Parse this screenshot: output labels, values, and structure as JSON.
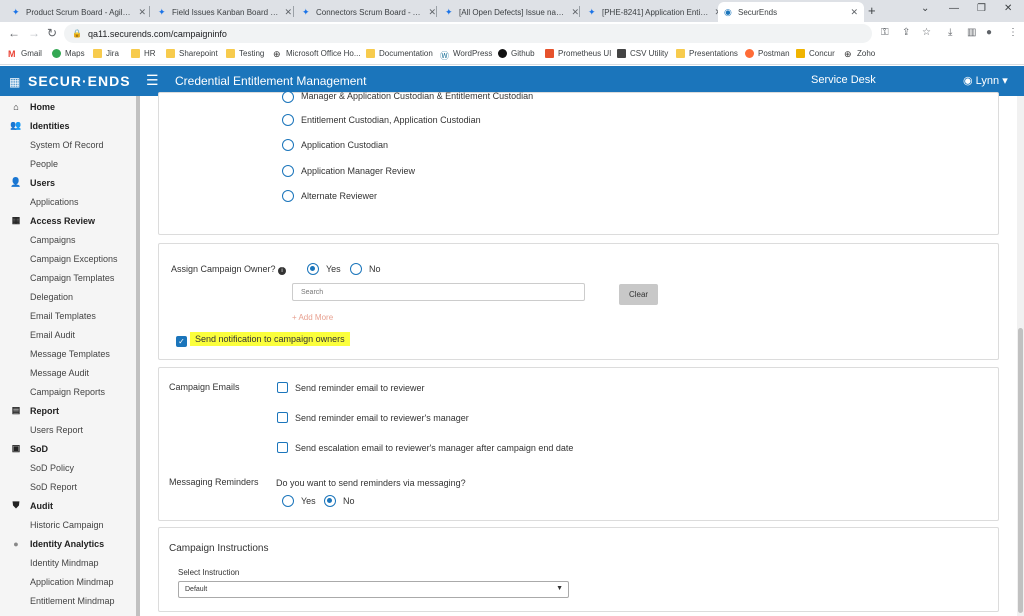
{
  "browser": {
    "tabs": [
      {
        "label": "Product Scrum Board - Agile Bo..."
      },
      {
        "label": "Field Issues Kanban Board - Agile..."
      },
      {
        "label": "Connectors Scrum Board - Agile..."
      },
      {
        "label": "[All Open Defects] Issue navigat..."
      },
      {
        "label": "[PHE-8241] Application Entitlem..."
      },
      {
        "label": "SecurEnds"
      }
    ],
    "url": "qa11.securends.com/campaigninfo",
    "bookmarks": [
      "Gmail",
      "Maps",
      "Jira",
      "HR",
      "Sharepoint",
      "Testing",
      "Microsoft Office Ho...",
      "Documentation",
      "WordPress",
      "Github",
      "Prometheus UI",
      "CSV Utility",
      "Presentations",
      "Postman",
      "Concur",
      "Zoho"
    ]
  },
  "app": {
    "logo": "SECUR·ENDS",
    "title": "Credential Entitlement Management",
    "service_desk": "Service Desk",
    "user": "Lynn"
  },
  "sidebar": {
    "sections": [
      {
        "label": "Home",
        "items": []
      },
      {
        "label": "Identities",
        "items": [
          "System Of Record",
          "People"
        ]
      },
      {
        "label": "Users",
        "items": [
          "Applications"
        ]
      },
      {
        "label": "Access Review",
        "items": [
          "Campaigns",
          "Campaign Exceptions",
          "Campaign Templates",
          "Delegation",
          "Email Templates",
          "Email Audit",
          "Message Templates",
          "Message Audit",
          "Campaign Reports"
        ]
      },
      {
        "label": "Report",
        "items": [
          "Users Report"
        ]
      },
      {
        "label": "SoD",
        "items": [
          "SoD Policy",
          "SoD Report"
        ]
      },
      {
        "label": "Audit",
        "items": [
          "Historic Campaign"
        ]
      },
      {
        "label": "Identity Analytics",
        "items": [
          "Identity Mindmap",
          "Application Mindmap",
          "Entitlement Mindmap"
        ]
      }
    ]
  },
  "reviewer_options": [
    "Manager & Application Custodian & Entitlement Custodian",
    "Entitlement Custodian, Application Custodian",
    "Application Custodian",
    "Application Manager Review",
    "Alternate Reviewer"
  ],
  "owner": {
    "label": "Assign Campaign Owner?",
    "yes": "Yes",
    "no": "No",
    "search_placeholder": "Search",
    "clear": "Clear",
    "add_more": "+ Add More",
    "notify": "Send notification to campaign owners"
  },
  "emails": {
    "label": "Campaign Emails",
    "options": [
      "Send reminder email to reviewer",
      "Send reminder email to reviewer's manager",
      "Send escalation email to reviewer's manager after campaign end date"
    ],
    "messaging_label": "Messaging Reminders",
    "messaging_question": "Do you want to send reminders via messaging?",
    "yes": "Yes",
    "no": "No"
  },
  "instructions": {
    "title": "Campaign Instructions",
    "select_label": "Select Instruction",
    "selected": "Default"
  }
}
